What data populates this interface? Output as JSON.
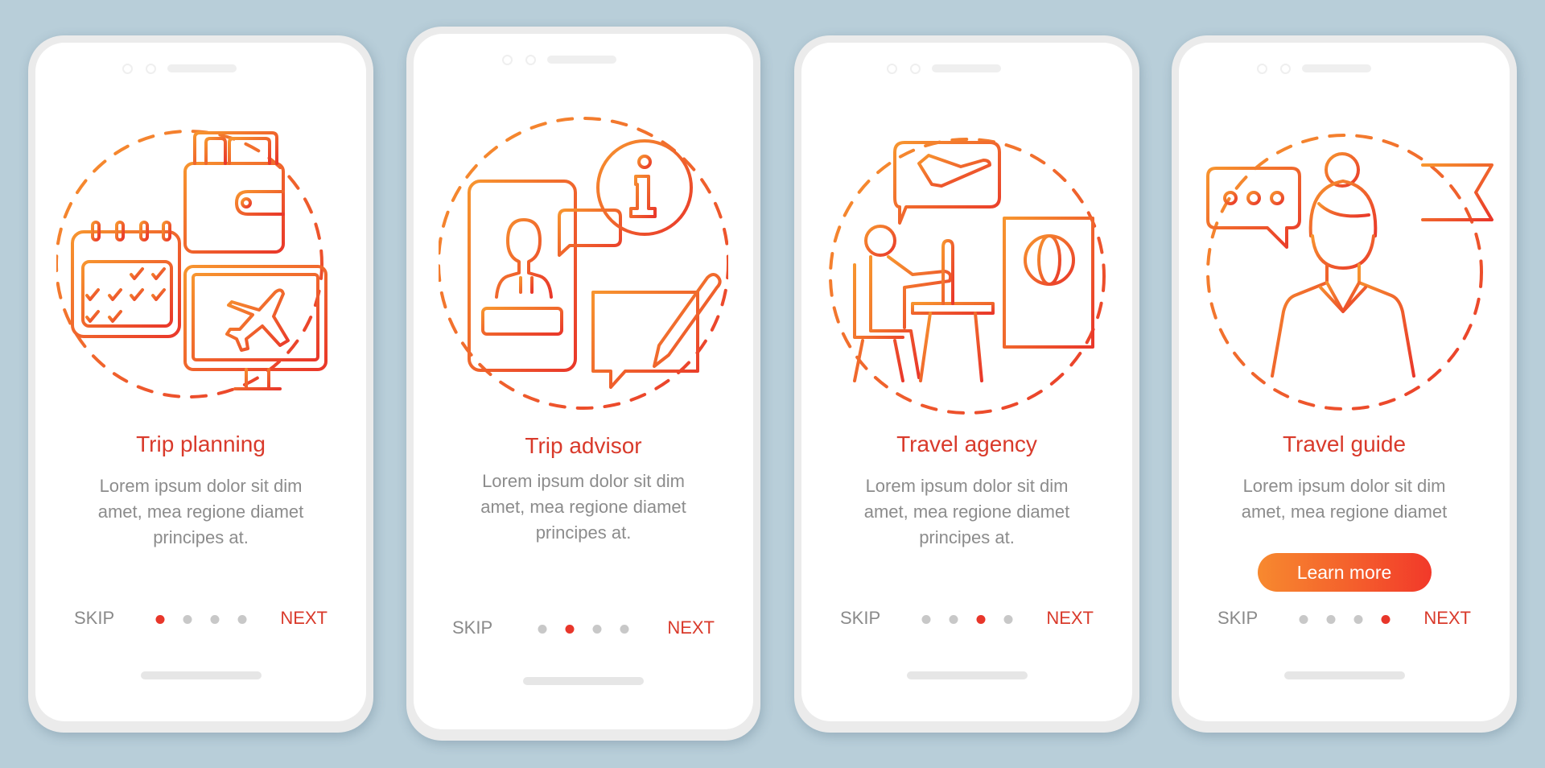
{
  "theme": {
    "background": "#b8ced9",
    "accent_red": "#d93a2b",
    "gradient_start": "#f7892f",
    "gradient_end": "#f2392a",
    "body_text": "#8c8c8c",
    "dot_inactive": "#c8c8c8",
    "dot_active": "#e8362a"
  },
  "screens": [
    {
      "illustration": "trip-planning-illustration",
      "icons": [
        "calendar-icon",
        "wallet-icon",
        "monitor-airplane-icon"
      ],
      "title": "Trip planning",
      "body_lines": [
        "Lorem ipsum dolor sit dim",
        "amet, mea regione diamet",
        "principes at."
      ],
      "skip_label": "SKIP",
      "next_label": "NEXT",
      "page_index": 1,
      "page_count": 4
    },
    {
      "illustration": "trip-advisor-illustration",
      "icons": [
        "smartphone-person-icon",
        "chat-bubble-icon",
        "info-icon",
        "note-pencil-icon"
      ],
      "title": "Trip advisor",
      "body_lines": [
        "Lorem ipsum dolor sit dim",
        "amet, mea regione diamet",
        "principes at."
      ],
      "skip_label": "SKIP",
      "next_label": "NEXT",
      "page_index": 2,
      "page_count": 4
    },
    {
      "illustration": "travel-agency-illustration",
      "icons": [
        "airplane-bubble-icon",
        "person-at-desk-icon",
        "passport-globe-icon"
      ],
      "title": "Travel agency",
      "body_lines": [
        "Lorem ipsum dolor sit dim",
        "amet, mea regione diamet",
        "principes at."
      ],
      "skip_label": "SKIP",
      "next_label": "NEXT",
      "page_index": 3,
      "page_count": 4
    },
    {
      "illustration": "travel-guide-illustration",
      "icons": [
        "ellipsis-bubble-icon",
        "woman-guide-icon",
        "flag-icon"
      ],
      "title": "Travel guide",
      "body_lines": [
        "Lorem ipsum dolor sit dim",
        "amet, mea regione diamet"
      ],
      "cta_label": "Learn more",
      "skip_label": "SKIP",
      "next_label": "NEXT",
      "page_index": 4,
      "page_count": 4
    }
  ]
}
